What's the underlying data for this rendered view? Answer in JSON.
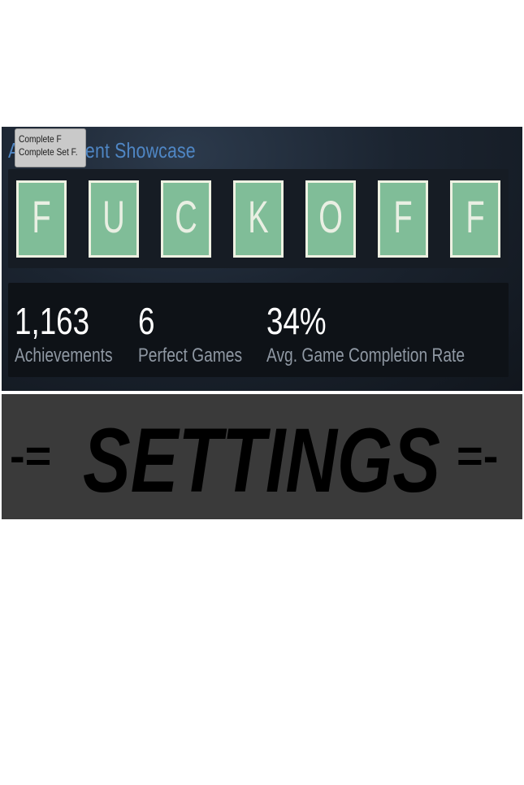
{
  "tooltip": {
    "line1": "Complete F",
    "line2": "Complete Set F."
  },
  "showcase": {
    "title": "Achievement Showcase"
  },
  "tiles": [
    "F",
    "U",
    "C",
    "K",
    "O",
    "F",
    "F"
  ],
  "stats": [
    {
      "value": "1,163",
      "label": "Achievements"
    },
    {
      "value": "6",
      "label": "Perfect Games"
    },
    {
      "value": "34%",
      "label": "Avg. Game Completion Rate"
    }
  ],
  "banner": {
    "text": "SETTINGS",
    "left_deco": "-=",
    "right_deco": "=-"
  },
  "colors": {
    "tile": "#80bd98",
    "title": "#4f86c4",
    "banner_bg": "#3a3a3a"
  }
}
